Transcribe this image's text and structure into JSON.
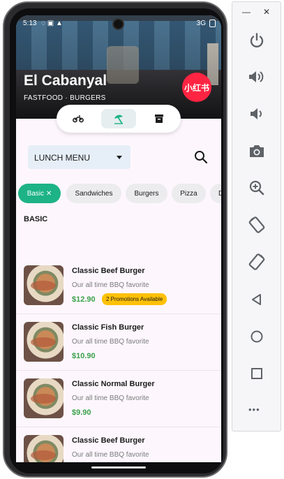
{
  "status_bar": {
    "time": "5:13",
    "status_icons": "◌ ▣ ▲",
    "network": "3G"
  },
  "store": {
    "name": "El Cabanyal",
    "category": "FASTFOOD · BURGERS",
    "logo_text": "小红书"
  },
  "modes": [
    {
      "icon": "motorcycle-icon",
      "active": false
    },
    {
      "icon": "beach-umbrella-icon",
      "active": true
    },
    {
      "icon": "archive-box-icon",
      "active": false
    }
  ],
  "menu_dropdown": {
    "selected": "LUNCH MENU"
  },
  "chips": [
    {
      "label": "Basic ✕",
      "active": true
    },
    {
      "label": "Sandwiches",
      "active": false
    },
    {
      "label": "Burgers",
      "active": false
    },
    {
      "label": "Pizza",
      "active": false
    },
    {
      "label": "D",
      "active": false
    }
  ],
  "section_title": "BASIC",
  "items": [
    {
      "title": "Classic Beef Burger",
      "desc": "Our all time BBQ favorite",
      "price": "$12.90",
      "promo": "2 Promotions Available"
    },
    {
      "title": "Classic Fish Burger",
      "desc": "Our all time BBQ favorite",
      "price": "$10.90",
      "promo": ""
    },
    {
      "title": "Classic Normal Burger",
      "desc": "Our all time BBQ favorite",
      "price": "$9.90",
      "promo": ""
    },
    {
      "title": "Classic Beef Burger",
      "desc": "Our all time BBQ favorite",
      "price": "",
      "promo": ""
    }
  ],
  "emulator_panel": {
    "minimize": "—",
    "close": "✕",
    "more": "•••"
  },
  "colors": {
    "accent": "#1db386",
    "price": "#3aa04a",
    "promo": "#ffc107",
    "logo": "#ff2442"
  }
}
